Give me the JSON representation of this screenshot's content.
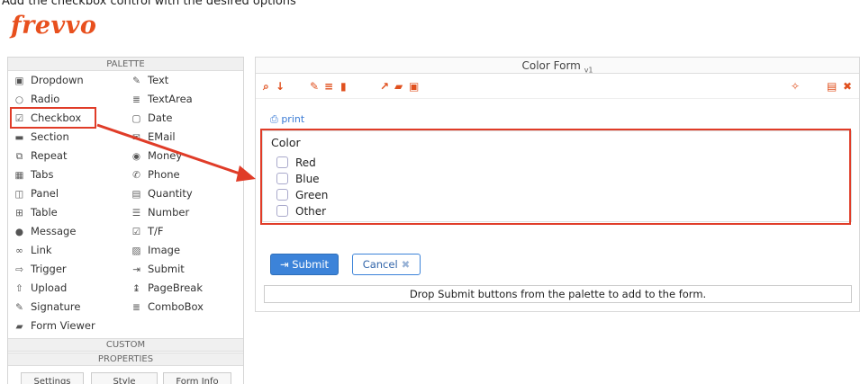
{
  "caption": "Add the checkbox control with the desired options",
  "logo": "frevvo",
  "palette": {
    "header": "PALETTE",
    "col1": [
      {
        "label": "Dropdown",
        "icon": "dropdown-icon",
        "glyph": "▣"
      },
      {
        "label": "Radio",
        "icon": "radio-icon",
        "glyph": "○"
      },
      {
        "label": "Checkbox",
        "icon": "checkbox-icon",
        "glyph": "☑"
      },
      {
        "label": "Section",
        "icon": "folder-icon",
        "glyph": "▬"
      },
      {
        "label": "Repeat",
        "icon": "repeat-icon",
        "glyph": "⧉"
      },
      {
        "label": "Tabs",
        "icon": "tabs-icon",
        "glyph": "▦"
      },
      {
        "label": "Panel",
        "icon": "panel-icon",
        "glyph": "◫"
      },
      {
        "label": "Table",
        "icon": "table-icon",
        "glyph": "⊞"
      },
      {
        "label": "Message",
        "icon": "message-icon",
        "glyph": "●"
      },
      {
        "label": "Link",
        "icon": "link-icon",
        "glyph": "∞"
      },
      {
        "label": "Trigger",
        "icon": "trigger-icon",
        "glyph": "⇨"
      },
      {
        "label": "Upload",
        "icon": "upload-icon",
        "glyph": "⇧"
      },
      {
        "label": "Signature",
        "icon": "pencil-icon",
        "glyph": "✎"
      },
      {
        "label": "Form Viewer",
        "icon": "book-icon",
        "glyph": "▰"
      }
    ],
    "col2": [
      {
        "label": "Text",
        "icon": "edit-icon",
        "glyph": "✎"
      },
      {
        "label": "TextArea",
        "icon": "textarea-icon",
        "glyph": "≣"
      },
      {
        "label": "Date",
        "icon": "calendar-icon",
        "glyph": "▢"
      },
      {
        "label": "EMail",
        "icon": "email-icon",
        "glyph": "✉"
      },
      {
        "label": "Money",
        "icon": "money-icon",
        "glyph": "◉"
      },
      {
        "label": "Phone",
        "icon": "phone-icon",
        "glyph": "✆"
      },
      {
        "label": "Quantity",
        "icon": "keyboard-icon",
        "glyph": "▤"
      },
      {
        "label": "Number",
        "icon": "number-list-icon",
        "glyph": "☰"
      },
      {
        "label": "T/F",
        "icon": "checkbox-tf-icon",
        "glyph": "☑"
      },
      {
        "label": "Image",
        "icon": "image-icon",
        "glyph": "▨"
      },
      {
        "label": "Submit",
        "icon": "submit-icon",
        "glyph": "⇥"
      },
      {
        "label": "PageBreak",
        "icon": "pagebreak-icon",
        "glyph": "↨"
      },
      {
        "label": "ComboBox",
        "icon": "combobox-icon",
        "glyph": "≣"
      }
    ],
    "custom_header": "CUSTOM",
    "properties_header": "PROPERTIES",
    "tabs": [
      "Settings",
      "Style",
      "Form Info"
    ]
  },
  "form": {
    "title": "Color Form",
    "version": "v1",
    "print_label": "print",
    "field_label": "Color",
    "options": [
      "Red",
      "Blue",
      "Green",
      "Other"
    ],
    "submit_label": "Submit",
    "cancel_label": "Cancel",
    "drop_hint": "Drop Submit buttons from the palette to add to the form."
  },
  "colors": {
    "brand": "#e8501e",
    "annotation": "#e03c28",
    "primary_button": "#3c83d9"
  }
}
